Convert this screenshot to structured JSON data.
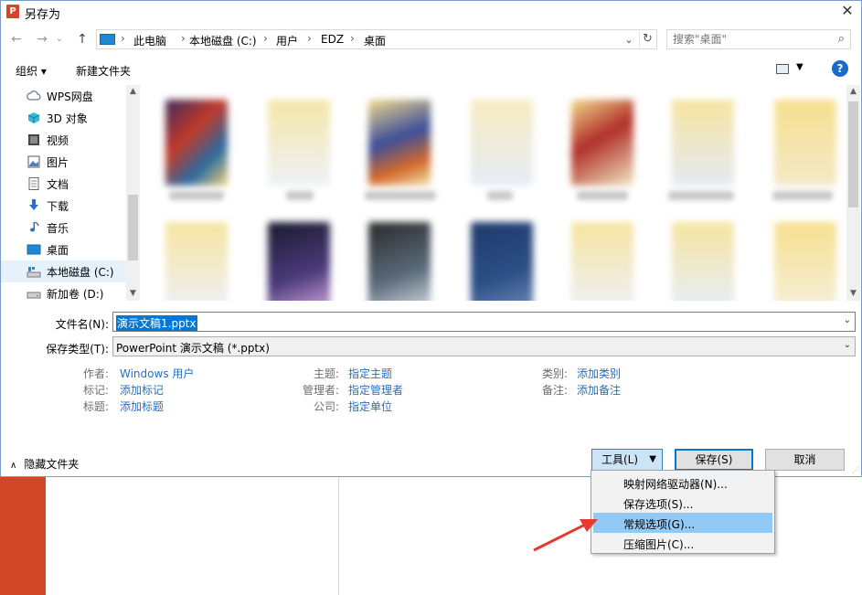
{
  "window": {
    "title": "另存为",
    "close_glyph": "✕"
  },
  "nav": {
    "back_glyph": "←",
    "forward_glyph": "→",
    "recent_glyph": "⌄",
    "up_glyph": "↑",
    "breadcrumbs": [
      "此电脑",
      "本地磁盘 (C:)",
      "用户",
      "EDZ",
      "桌面"
    ],
    "separator": "›",
    "refresh_glyph": "↻",
    "search_placeholder": "搜索\"桌面\""
  },
  "toolbar": {
    "organize": "组织 ▾",
    "new_folder": "新建文件夹",
    "help": "?"
  },
  "sidebar": {
    "items": [
      {
        "label": "WPS网盘",
        "icon": "cloud-icon"
      },
      {
        "label": "3D 对象",
        "icon": "cube-icon"
      },
      {
        "label": "视频",
        "icon": "video-icon"
      },
      {
        "label": "图片",
        "icon": "picture-icon"
      },
      {
        "label": "文档",
        "icon": "document-icon"
      },
      {
        "label": "下载",
        "icon": "download-icon"
      },
      {
        "label": "音乐",
        "icon": "music-icon"
      },
      {
        "label": "桌面",
        "icon": "desktop-icon"
      },
      {
        "label": "本地磁盘 (C:)",
        "icon": "drive-icon",
        "selected": true
      },
      {
        "label": "新加卷 (D:)",
        "icon": "drive-icon"
      }
    ]
  },
  "form": {
    "filename_label": "文件名(N):",
    "filename_value": "演示文稿1.pptx",
    "filetype_label": "保存类型(T):",
    "filetype_value": "PowerPoint 演示文稿 (*.pptx)"
  },
  "meta": {
    "author_k": "作者:",
    "author_v": "Windows 用户",
    "tags_k": "标记:",
    "tags_v": "添加标记",
    "title_k": "标题:",
    "title_v": "添加标题",
    "subject_k": "主题:",
    "subject_v": "指定主题",
    "manager_k": "管理者:",
    "manager_v": "指定管理者",
    "company_k": "公司:",
    "company_v": "指定单位",
    "category_k": "类别:",
    "category_v": "添加类别",
    "comments_k": "备注:",
    "comments_v": "添加备注"
  },
  "footer": {
    "hide_folders": "隐藏文件夹",
    "tools": "工具(L)",
    "save": "保存(S)",
    "cancel": "取消"
  },
  "tools_menu": {
    "items": [
      "映射网络驱动器(N)...",
      "保存选项(S)...",
      "常规选项(G)...",
      "压缩图片(C)..."
    ]
  },
  "colors": {
    "accent": "#0078d7",
    "highlight": "#91c9f7",
    "link": "#2a6ebb",
    "annotation_arrow": "#e8392f"
  }
}
